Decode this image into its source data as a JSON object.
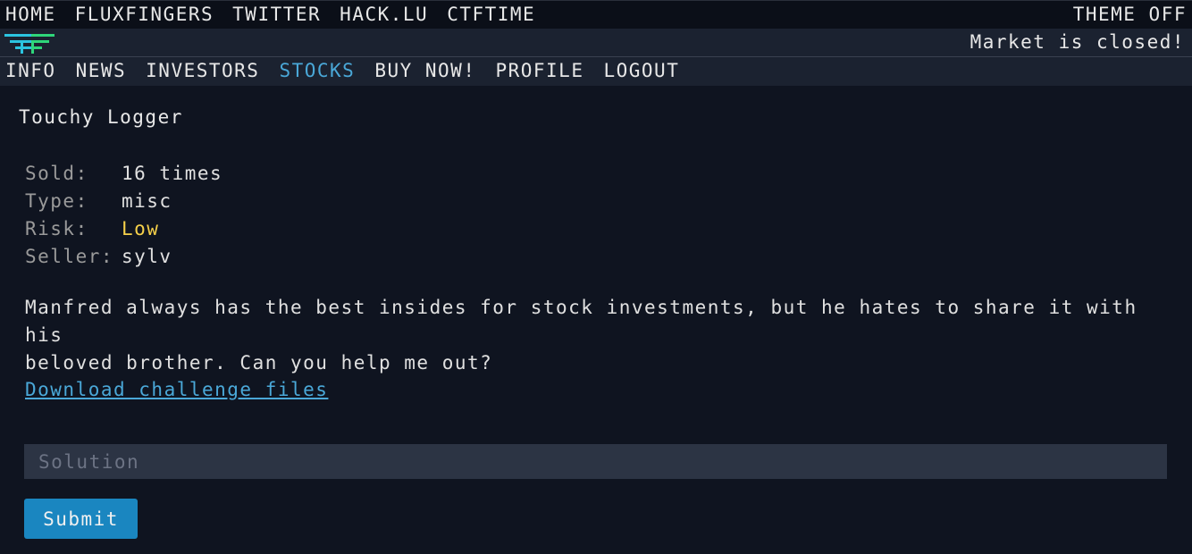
{
  "top_nav": {
    "links": [
      "HOME",
      "FLUXFINGERS",
      "TWITTER",
      "HACK.LU",
      "CTFTIME"
    ],
    "theme_toggle": "THEME OFF"
  },
  "status": {
    "logo": "fluxfingers-logo-icon",
    "market_text": "Market is closed!"
  },
  "main_nav": {
    "links": [
      "INFO",
      "NEWS",
      "INVESTORS",
      "STOCKS",
      "BUY NOW!",
      "PROFILE",
      "LOGOUT"
    ],
    "active": "STOCKS"
  },
  "challenge": {
    "title": "Touchy Logger",
    "props": {
      "sold_label": "Sold:",
      "sold_value": "16 times",
      "type_label": "Type:",
      "type_value": "misc",
      "risk_label": "Risk:",
      "risk_value": "Low",
      "seller_label": "Seller:",
      "seller_value": "sylv"
    },
    "description_line1": "Manfred always has the best insides for stock investments, but he hates to share it with his",
    "description_line2": "beloved brother. Can you help me out?",
    "download_link": "Download challenge files"
  },
  "form": {
    "solution_placeholder": "Solution",
    "solution_value": "",
    "submit_label": "Submit"
  },
  "colors": {
    "background": "#0f1420",
    "bar": "#1b2230",
    "accent": "#4aa8d8",
    "risk_low": "#f5d04a",
    "button": "#1a86c0",
    "logo_cyan": "#2bc4e0",
    "logo_green": "#2fd67a"
  }
}
